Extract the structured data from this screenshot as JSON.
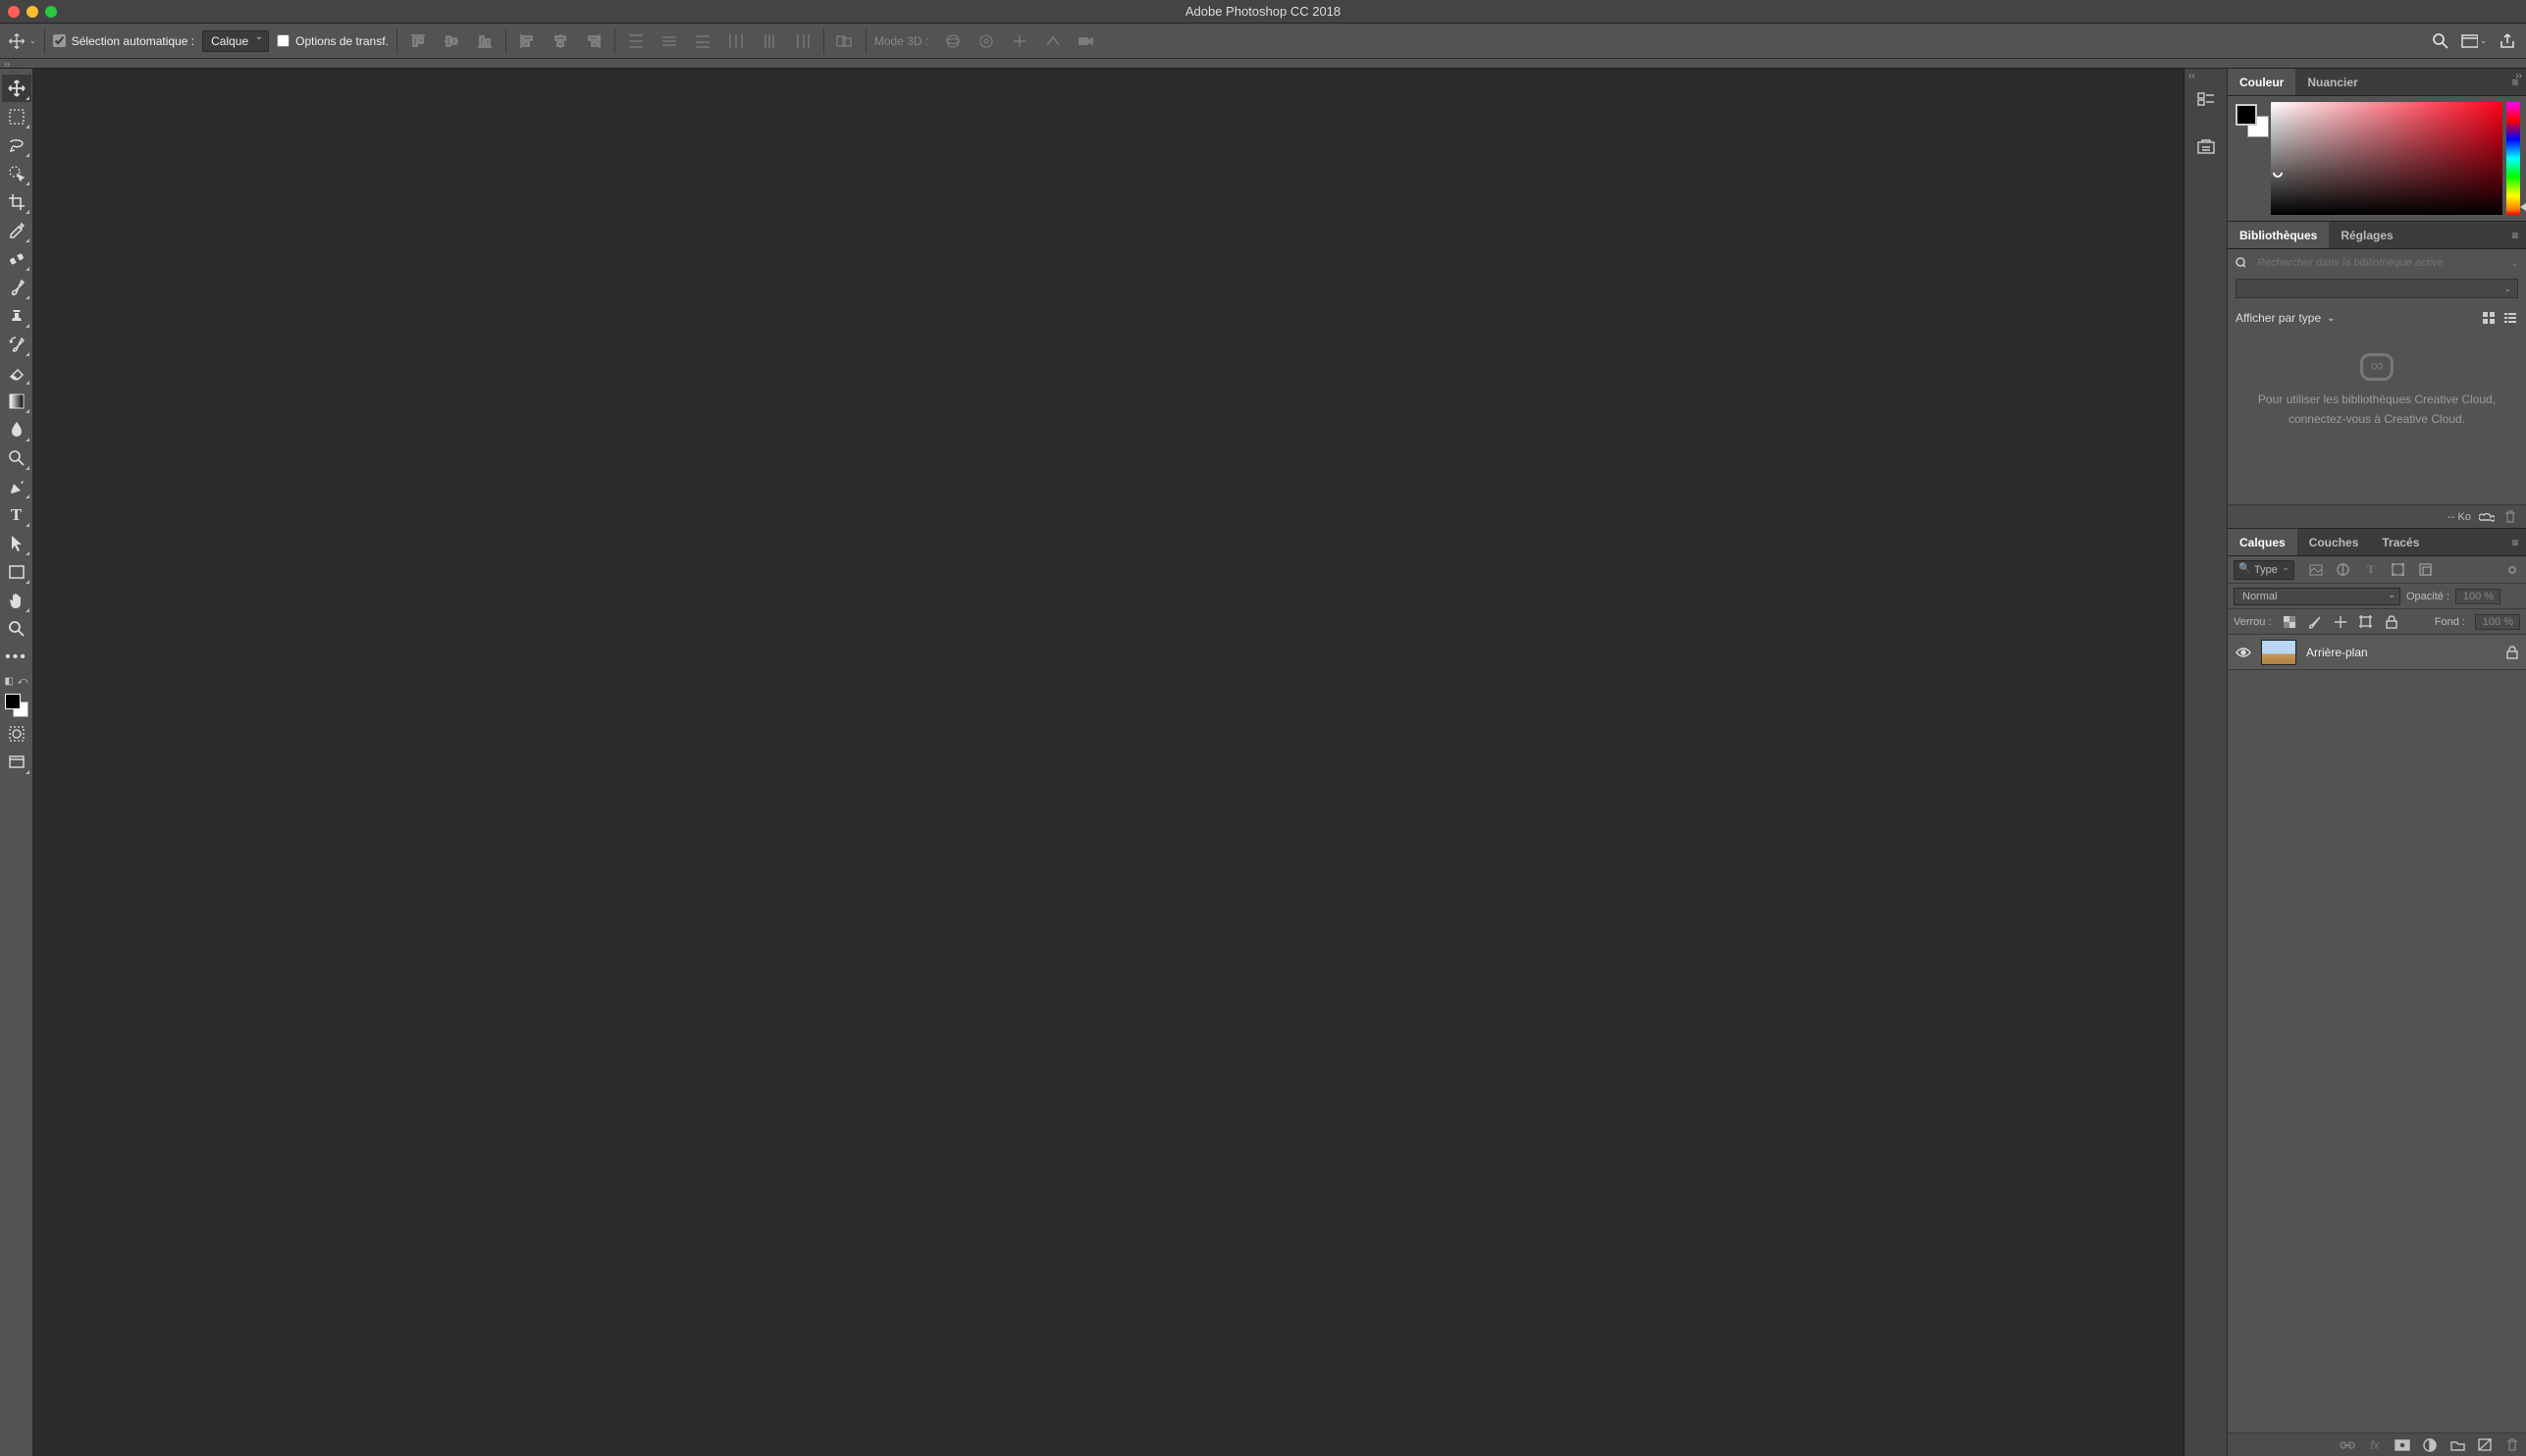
{
  "title": "Adobe Photoshop CC 2018",
  "optionsbar": {
    "auto_select_label": "Sélection automatique :",
    "auto_select_checked": true,
    "layer_select": "Calque",
    "transform_label": "Options de transf.",
    "transform_checked": false,
    "mode3d_label": "Mode 3D :"
  },
  "tools": [
    {
      "name": "move-tool",
      "active": true,
      "group": true
    },
    {
      "name": "rect-marquee-tool",
      "group": true
    },
    {
      "name": "lasso-tool",
      "group": true
    },
    {
      "name": "quick-select-tool",
      "group": true
    },
    {
      "name": "crop-tool",
      "group": true
    },
    {
      "name": "eyedropper-tool",
      "group": true
    },
    {
      "name": "healing-brush-tool",
      "group": true
    },
    {
      "name": "brush-tool",
      "group": true
    },
    {
      "name": "clone-stamp-tool",
      "group": true
    },
    {
      "name": "history-brush-tool",
      "group": true
    },
    {
      "name": "eraser-tool",
      "group": true
    },
    {
      "name": "gradient-tool",
      "group": true
    },
    {
      "name": "blur-tool",
      "group": true
    },
    {
      "name": "dodge-tool",
      "group": true
    },
    {
      "name": "pen-tool",
      "group": true
    },
    {
      "name": "type-tool",
      "group": true
    },
    {
      "name": "path-select-tool",
      "group": true
    },
    {
      "name": "rectangle-shape-tool",
      "group": true
    },
    {
      "name": "hand-tool",
      "group": true
    },
    {
      "name": "zoom-tool",
      "group": false
    }
  ],
  "panels": {
    "color": {
      "tab_color": "Couleur",
      "tab_swatches": "Nuancier"
    },
    "libraries": {
      "tab_lib": "Bibliothèques",
      "tab_adjust": "Réglages",
      "search_placeholder": "Rechercher dans la bibliothèque active",
      "filter_label": "Afficher par type",
      "empty_line1": "Pour utiliser les bibliothèques Creative Cloud,",
      "empty_line2": "connectez-vous à Creative Cloud.",
      "size_label": "-- Ko"
    },
    "layers": {
      "tab_layers": "Calques",
      "tab_channels": "Couches",
      "tab_paths": "Tracés",
      "filter_type": "Type",
      "blend_mode": "Normal",
      "opacity_label": "Opacité :",
      "opacity_value": "100 %",
      "lock_label": "Verrou :",
      "fill_label": "Fond :",
      "fill_value": "100 %",
      "layer0_name": "Arrière-plan"
    }
  }
}
